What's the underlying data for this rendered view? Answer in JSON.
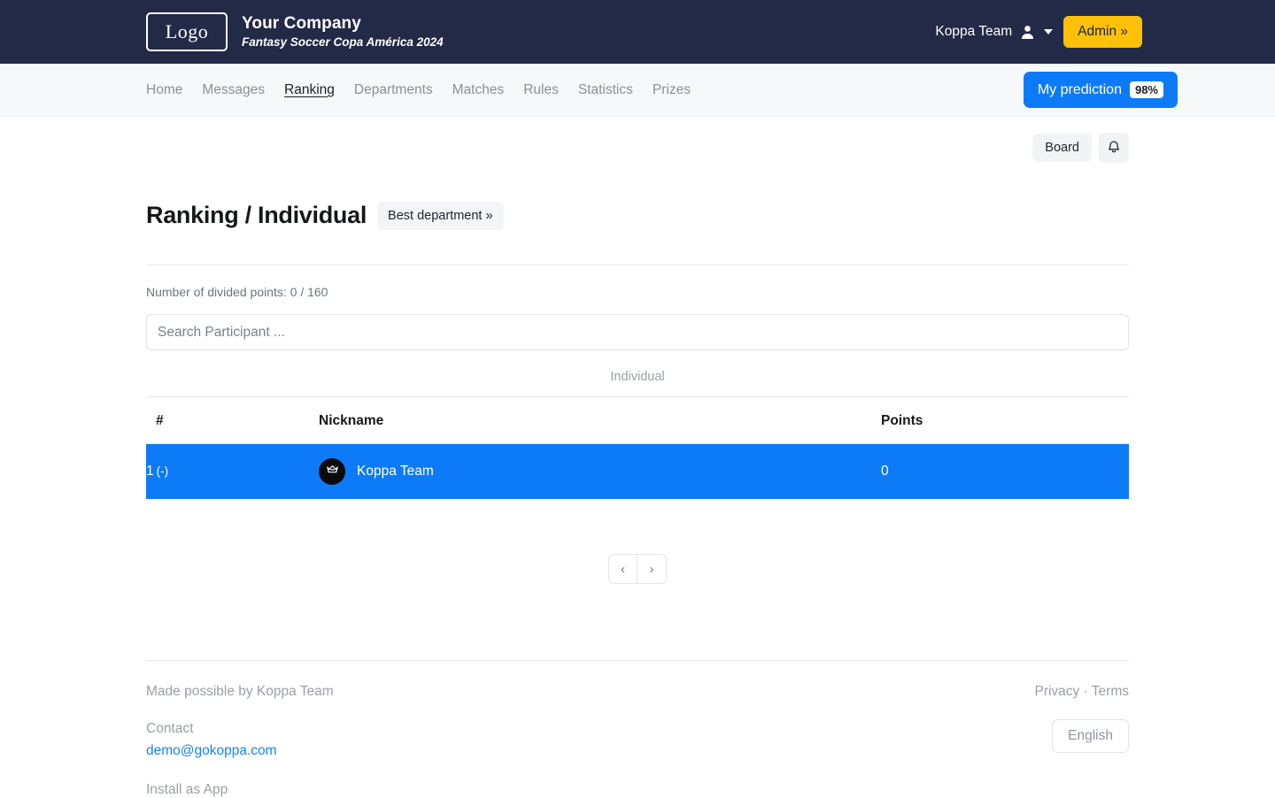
{
  "header": {
    "logo_text": "Logo",
    "company": "Your Company",
    "tagline": "Fantasy Soccer Copa América 2024",
    "user_name": "Koppa Team",
    "admin_label": "Admin »",
    "accent_navy": "#222a47",
    "accent_amber": "#ffc107"
  },
  "nav": {
    "items": [
      {
        "label": "Home",
        "active": false
      },
      {
        "label": "Messages",
        "active": false
      },
      {
        "label": "Ranking",
        "active": true
      },
      {
        "label": "Departments",
        "active": false
      },
      {
        "label": "Matches",
        "active": false
      },
      {
        "label": "Rules",
        "active": false
      },
      {
        "label": "Statistics",
        "active": false
      },
      {
        "label": "Prizes",
        "active": false
      }
    ],
    "prediction_label": "My prediction",
    "prediction_badge": "98%",
    "prediction_color": "#0d7bf7"
  },
  "subbar": {
    "board_label": "Board",
    "bell_icon": "bell-icon"
  },
  "main": {
    "title": "Ranking / Individual",
    "best_department_label": "Best department »",
    "divided_points": "Number of divided points: 0 / 160",
    "search_placeholder": "Search Participant ...",
    "search_value": "",
    "tab_label": "Individual",
    "table": {
      "columns": [
        "#",
        "Nickname",
        "Points"
      ],
      "rows": [
        {
          "rank": "1",
          "rank_delta": "(-)",
          "avatar_icon": "crown-emblem-icon",
          "nickname": "Koppa Team",
          "points": "0",
          "highlighted": true
        }
      ]
    },
    "pagination": {
      "prev": "‹",
      "next": "›"
    },
    "highlight_color": "#0d7bf7"
  },
  "footer": {
    "made_by": "Made possible by Koppa Team",
    "contact_label": "Contact",
    "email": "demo@gokoppa.com",
    "install_label": "Install as App",
    "legal": "Privacy · Terms",
    "language": "English"
  }
}
